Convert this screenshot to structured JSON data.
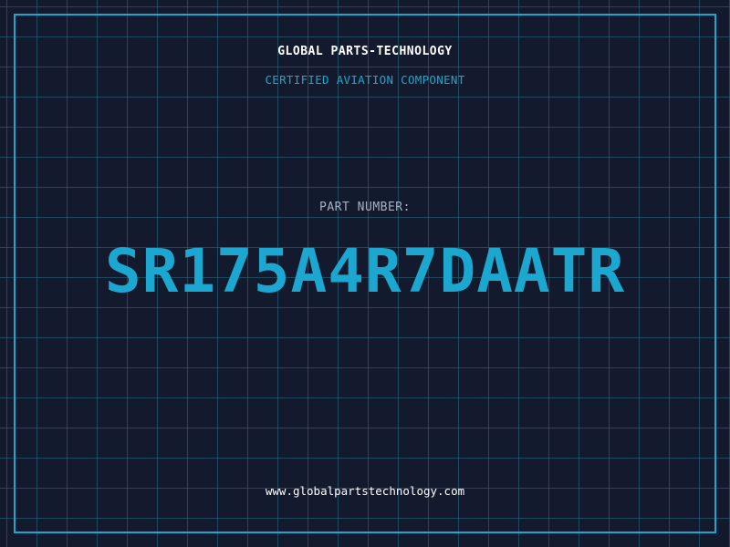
{
  "header": {
    "company_name": "GLOBAL PARTS-TECHNOLOGY",
    "tagline": "CERTIFIED AVIATION COMPONENT"
  },
  "main": {
    "part_label": "PART NUMBER:",
    "part_number": "SR175A4R7DAATR"
  },
  "footer": {
    "website": "www.globalpartstechnology.com"
  },
  "colors": {
    "background": "#131a2e",
    "grid": "#266e82",
    "accent": "#1ba7cf",
    "text_primary": "#ffffff",
    "text_muted": "#a9b1bd"
  }
}
